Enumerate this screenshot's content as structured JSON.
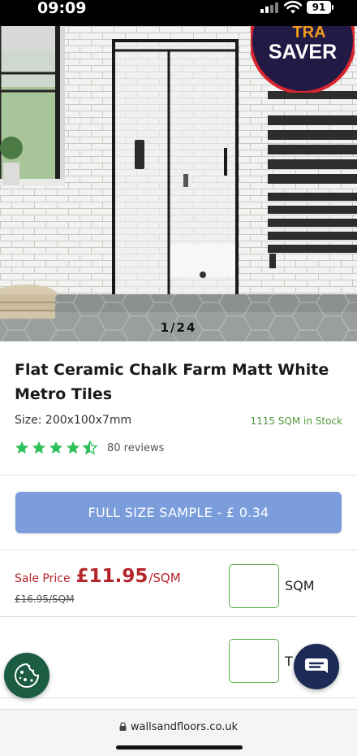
{
  "status_bar": {
    "time": "09:09",
    "battery": "91"
  },
  "gallery": {
    "counter": "1/24",
    "badge_top": "TRA",
    "badge_bottom": "SAVER"
  },
  "product": {
    "title": "Flat Ceramic Chalk Farm Matt White Metro Tiles",
    "size": "Size: 200x100x7mm",
    "stock": "1115 SQM in Stock",
    "rating": 4.5,
    "reviews": "80 reviews"
  },
  "sample_button": {
    "label": "FULL SIZE SAMPLE - £ 0.34"
  },
  "pricing": {
    "sale_label": "Sale Price",
    "sale_price": "£11.95",
    "unit": "/SQM",
    "old_price": "£16.95/SQM"
  },
  "quantity": {
    "sqm_label": "SQM",
    "tiles_label": "T"
  },
  "browser": {
    "url": "wallsandfloors.co.uk"
  },
  "colors": {
    "accent_button": "#7b9ddc",
    "sale_red": "#b3262b",
    "stock_green": "#4f9a3a",
    "star_green": "#2ec05b",
    "cookie_green": "#1b5c43",
    "chat_navy": "#1c2a56"
  }
}
